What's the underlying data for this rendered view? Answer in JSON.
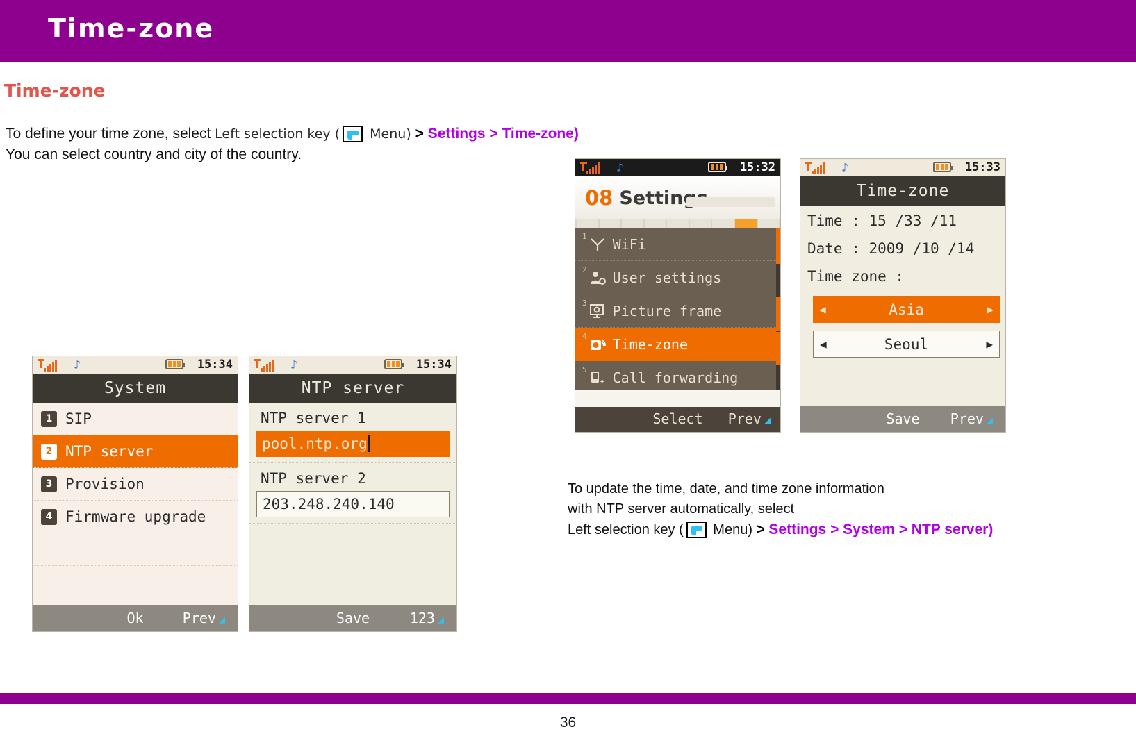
{
  "banner": {
    "title": "Time-zone"
  },
  "section": {
    "heading": "Time-zone"
  },
  "intro": {
    "part1": "To define your time zone, select ",
    "part2": "Left selection key (",
    "menu_icon": "menu-soft-key-icon",
    "part3": " Menu)",
    "gt": ">",
    "path": "Settings > Time-zone)",
    "line2": "You  can select  country and city of the country."
  },
  "note": {
    "line1": "To update the time, date, and time zone information",
    "line2": "with NTP server automatically, select",
    "line3": "Left selection key (",
    "menu_icon": "menu-soft-key-icon",
    "line3b": " Menu)",
    "gt": ">",
    "path": "Settings > System > NTP server)"
  },
  "phone_settings": {
    "status": {
      "time": "15:32",
      "signal_icon": "signal-bars-icon",
      "sound_icon": "music-note-icon",
      "battery_icon": "battery-icon"
    },
    "header": {
      "number": "08",
      "title": "Settings"
    },
    "items": [
      {
        "index": "1",
        "label": "WiFi",
        "icon": "wifi-icon",
        "selected": false
      },
      {
        "index": "2",
        "label": "User settings",
        "icon": "user-settings-icon",
        "selected": false
      },
      {
        "index": "3",
        "label": "Picture frame",
        "icon": "picture-frame-icon",
        "selected": false
      },
      {
        "index": "4",
        "label": "Time-zone",
        "icon": "time-zone-icon",
        "selected": true
      },
      {
        "index": "5",
        "label": "Call forwarding",
        "icon": "call-forwarding-icon",
        "selected": false
      }
    ],
    "softkeys": {
      "left": "Select",
      "right": "Prev"
    }
  },
  "phone_timezone": {
    "status": {
      "time": "15:33",
      "signal_icon": "signal-bars-icon",
      "sound_icon": "music-note-icon",
      "battery_icon": "battery-icon"
    },
    "title": "Time-zone",
    "time_label": "Time : 15 /33 /11",
    "date_label": "Date : 2009 /10 /14",
    "zone_label": "Time zone :",
    "region_value": "Asia",
    "city_value": "Seoul",
    "arrow_left": "◀",
    "arrow_right": "▶",
    "softkeys": {
      "left": "Save",
      "right": "Prev"
    }
  },
  "phone_system": {
    "status": {
      "time": "15:34",
      "signal_icon": "signal-bars-icon",
      "sound_icon": "music-note-icon",
      "battery_icon": "battery-icon"
    },
    "title": "System",
    "items": [
      {
        "index": "1",
        "label": "SIP",
        "selected": false
      },
      {
        "index": "2",
        "label": "NTP server",
        "selected": true
      },
      {
        "index": "3",
        "label": "Provision",
        "selected": false
      },
      {
        "index": "4",
        "label": "Firmware upgrade",
        "selected": false
      }
    ],
    "softkeys": {
      "left": "Ok",
      "right": "Prev"
    }
  },
  "phone_ntp": {
    "status": {
      "time": "15:34",
      "signal_icon": "signal-bars-icon",
      "sound_icon": "music-note-icon",
      "battery_icon": "battery-icon"
    },
    "title": "NTP server",
    "field1_label": "NTP server 1",
    "field1_value": "pool.ntp.org",
    "field2_label": "NTP server 2",
    "field2_value": "203.248.240.140",
    "softkeys": {
      "left": "Save",
      "right": "123"
    }
  },
  "footer": {
    "page_number": "36"
  },
  "colors": {
    "brand_purple": "#8e008e",
    "heading_red": "#e0554e",
    "link_magenta": "#b000e8",
    "accent_orange": "#ef6c00"
  }
}
